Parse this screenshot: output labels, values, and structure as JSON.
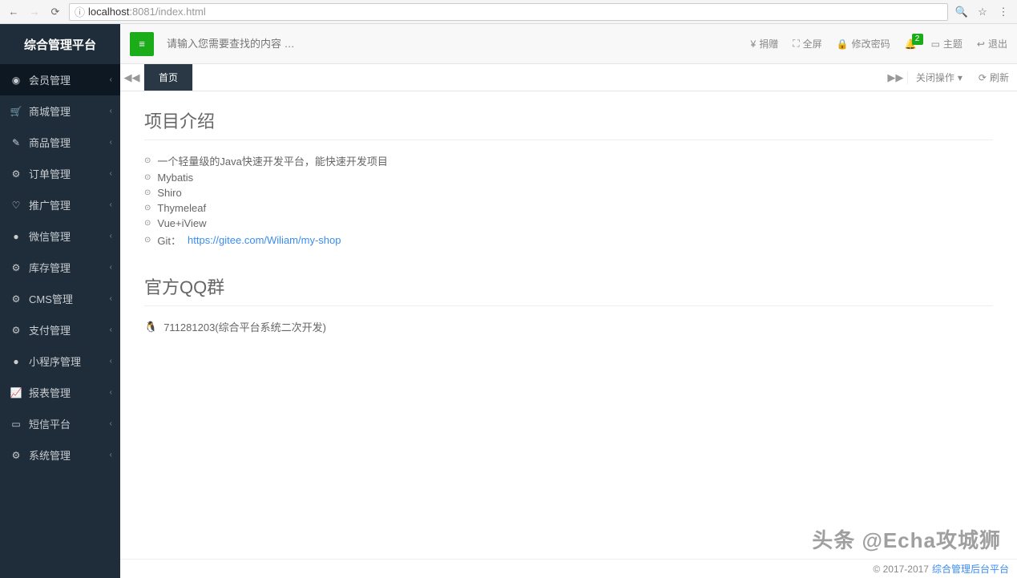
{
  "browser": {
    "url_prefix": "ⓘ",
    "url_host": "localhost",
    "url_rest": ":8081/index.html"
  },
  "sidebar": {
    "title": "综合管理平台",
    "items": [
      {
        "icon": "👤",
        "label": "会员管理"
      },
      {
        "icon": "🛒",
        "label": "商城管理"
      },
      {
        "icon": "✎",
        "label": "商品管理"
      },
      {
        "icon": "⚙",
        "label": "订单管理"
      },
      {
        "icon": "♡",
        "label": "推广管理"
      },
      {
        "icon": "💬",
        "label": "微信管理"
      },
      {
        "icon": "⚙",
        "label": "库存管理"
      },
      {
        "icon": "⚙",
        "label": "CMS管理"
      },
      {
        "icon": "⚙",
        "label": "支付管理"
      },
      {
        "icon": "💬",
        "label": "小程序管理"
      },
      {
        "icon": "📈",
        "label": "报表管理"
      },
      {
        "icon": "▭",
        "label": "短信平台"
      },
      {
        "icon": "⚙",
        "label": "系统管理"
      }
    ]
  },
  "header": {
    "search_placeholder": "请输入您需要查找的内容 …",
    "actions": {
      "donate": "捐赠",
      "fullscreen": "全屏",
      "password": "修改密码",
      "theme": "主题",
      "logout": "退出"
    },
    "badge": "2"
  },
  "tabs": {
    "home": "首页",
    "close_ops": "关闭操作",
    "refresh": "刷新"
  },
  "content": {
    "section1_title": "项目介绍",
    "section1_items": [
      "一个轻量级的Java快速开发平台，能快速开发项目",
      "Mybatis",
      "Shiro",
      "Thymeleaf",
      "Vue+iView"
    ],
    "git_label": "Git：",
    "git_url": "https://gitee.com/Wiliam/my-shop",
    "section2_title": "官方QQ群",
    "qq_group": "711281203(综合平台系统二次开发)"
  },
  "footer": {
    "copyright": "© 2017-2017",
    "link": "综合管理后台平台"
  },
  "watermark": "头条 @Echa攻城狮"
}
